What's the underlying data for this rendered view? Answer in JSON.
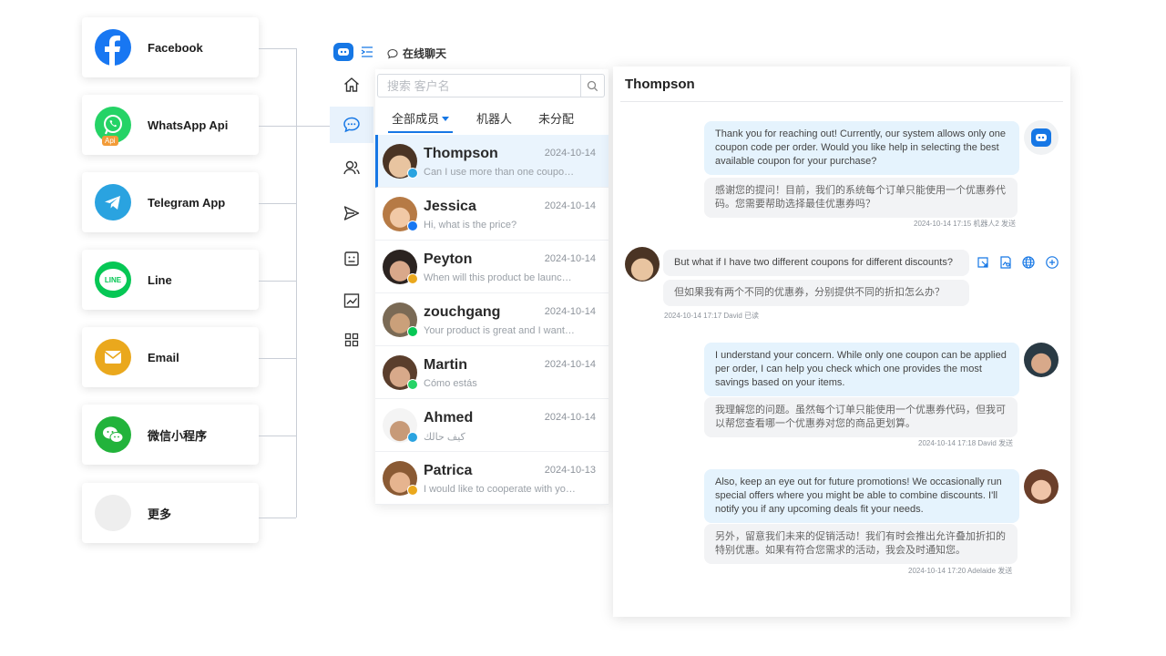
{
  "channels": [
    {
      "name": "Facebook",
      "icon": "facebook-icon",
      "color": "#1877f2"
    },
    {
      "name": "WhatsApp Api",
      "icon": "whatsapp-icon",
      "color": "#25d366",
      "badge": "Api"
    },
    {
      "name": "Telegram App",
      "icon": "telegram-icon",
      "color": "#2aa3e0"
    },
    {
      "name": "Line",
      "icon": "line-icon",
      "color": "#06c755",
      "icon_text": "LINE"
    },
    {
      "name": "Email",
      "icon": "email-icon",
      "color": "#eaa81d"
    },
    {
      "name": "微信小程序",
      "icon": "wechat-icon",
      "color": "#22b33b"
    },
    {
      "name": "更多",
      "icon": "more-placeholder-icon",
      "color": "#eeeeee"
    }
  ],
  "header": {
    "tab_label": "在线聊天",
    "accent": "#1677e5"
  },
  "nav": {
    "items": [
      "home-icon",
      "chat-icon",
      "contacts-icon",
      "send-icon",
      "robot-icon",
      "chart-icon",
      "apps-icon"
    ],
    "active": "chat-icon"
  },
  "search": {
    "placeholder": "搜索 客户名"
  },
  "filters": [
    "全部成员",
    "机器人",
    "未分配"
  ],
  "conversations": [
    {
      "name": "Thompson",
      "date": "2024-10-14",
      "preview": "Can I use more than one coupon ...",
      "channel": "telegram",
      "active": true
    },
    {
      "name": "Jessica",
      "date": "2024-10-14",
      "preview": "Hi, what is the price?",
      "channel": "facebook"
    },
    {
      "name": "Peyton",
      "date": "2024-10-14",
      "preview": "When will this product be launche...",
      "channel": "email"
    },
    {
      "name": "zouchgang",
      "date": "2024-10-14",
      "preview": "Your product is great and I want t...",
      "channel": "line"
    },
    {
      "name": "Martin",
      "date": "2024-10-14",
      "preview": "Cómo estás",
      "channel": "whatsapp"
    },
    {
      "name": "Ahmed",
      "date": "2024-10-14",
      "preview": "كيف حالك",
      "channel": "telegram"
    },
    {
      "name": "Patrica",
      "date": "2024-10-13",
      "preview": "I would like to cooperate with you...",
      "channel": "email"
    }
  ],
  "chat": {
    "title": "Thompson",
    "messages": [
      {
        "en": "Thank you for reaching out! Currently, our system allows only one coupon code per order. Would you like help in selecting the best available coupon for your purchase?",
        "cn": "感谢您的提问！目前，我们的系统每个订单只能使用一个优惠券代码。您需要帮助选择最佳优惠券吗？",
        "meta": "2024-10-14 17:15 机器人2 发送"
      },
      {
        "en": "But what if I have two different coupons for different discounts?",
        "cn": "但如果我有两个不同的优惠券，分别提供不同的折扣怎么办？",
        "meta": "2024-10-14 17:17 David 已读"
      },
      {
        "en": "I understand your concern. While only one coupon can be applied per order, I can help you check which one provides the most savings based on your items.",
        "cn": "我理解您的问题。虽然每个订单只能使用一个优惠券代码，但我可以帮您查看哪一个优惠券对您的商品更划算。",
        "meta": "2024-10-14 17:18 David 发送"
      },
      {
        "en": "Also, keep an eye out for future promotions! We occasionally run special offers where you might be able to combine discounts. I'll notify you if any upcoming deals fit your needs.",
        "cn": "另外，留意我们未来的促销活动！我们有时会推出允许叠加折扣的特别优惠。如果有符合您需求的活动，我会及时通知您。",
        "meta": "2024-10-14 17:20 Adelaide 发送"
      }
    ],
    "actions": [
      "screenshot-icon",
      "image-search-icon",
      "translate-icon",
      "add-icon"
    ]
  }
}
